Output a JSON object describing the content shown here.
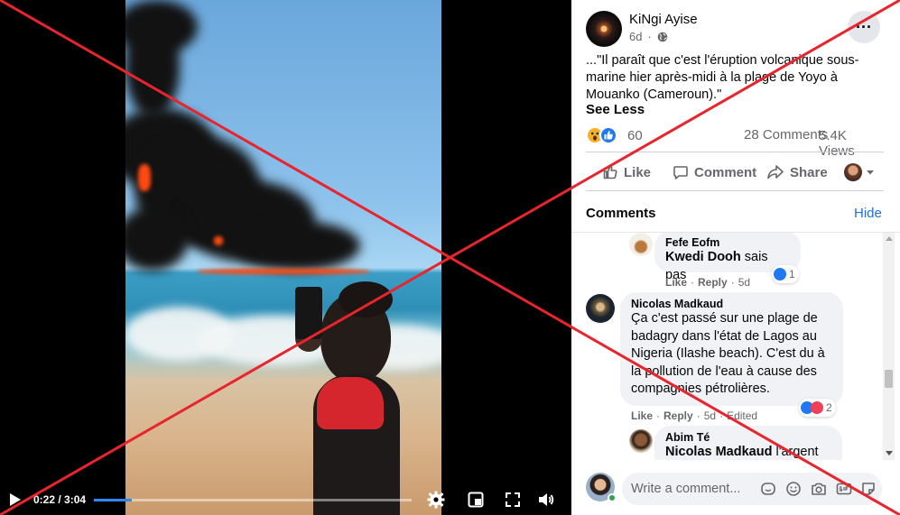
{
  "video": {
    "current_time": "0:22",
    "duration": "3:04",
    "time_separator": " / ",
    "progress": 0.12
  },
  "post": {
    "author": "KiNgi Ayise",
    "age": "6d",
    "audience_icon": "globe-icon",
    "caption": "...\"Il paraît que c'est l'éruption volcanique sous-marine hier après-midi à la plage de Yoyo à Mouanko (Cameroun).\"",
    "see_less": "See Less",
    "reactions_count": "60",
    "comments_count": "28 Comments",
    "views_count": "5.4K Views",
    "actions": {
      "like": "Like",
      "comment": "Comment",
      "share": "Share"
    }
  },
  "comments_section": {
    "title": "Comments",
    "hide": "Hide",
    "comments": [
      {
        "author": "Fefe Eofm",
        "text_tag": "Kwedi Dooh",
        "text": " sais pas",
        "like": "Like",
        "reply": "Reply",
        "age": "5d",
        "reaction_count": "1"
      },
      {
        "author": "Nicolas Madkaud",
        "text": "Ça c'est passé sur une plage de badagry dans l'état de Lagos au Nigeria (Ilashe beach). C'est du à la pollution de l'eau à cause des compagnies pétrolières.",
        "like": "Like",
        "reply": "Reply",
        "age": "5d",
        "edited": "Edited",
        "reaction_count": "2"
      },
      {
        "author": "Abim Té",
        "text_tag": "Nicolas Madkaud",
        "text": " l'argent"
      }
    ]
  },
  "composer": {
    "placeholder": "Write a comment..."
  },
  "colors": {
    "accent": "#216fdb",
    "like_blue": "#2078f4",
    "wow_yellow": "#f7b125",
    "love_red": "#f33e58",
    "cross_red": "#e8242c",
    "online_green": "#31a24c"
  }
}
